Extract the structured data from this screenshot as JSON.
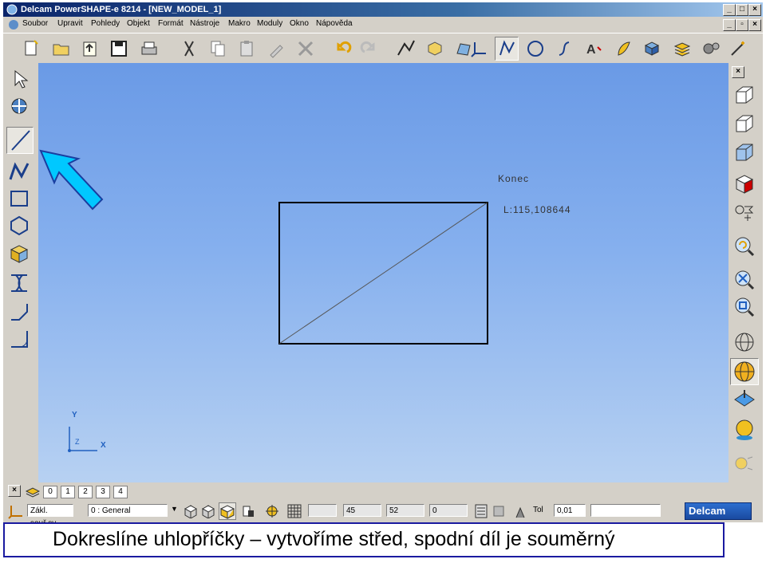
{
  "window": {
    "title": "Delcam PowerSHAPE-e 8214 - [NEW_MODEL_1]"
  },
  "menu": [
    "Soubor",
    "Upravit",
    "Pohledy",
    "Objekt",
    "Formát",
    "Nástroje",
    "Makro",
    "Moduly",
    "Okno",
    "Nápověda"
  ],
  "canvas": {
    "konec_label": "Konec",
    "length_label": "L:115,108644",
    "axis_y": "Y",
    "axis_x": "X",
    "axis_z": "Z"
  },
  "layers": [
    "0",
    "1",
    "2",
    "3",
    "4"
  ],
  "status": {
    "workplane": "Zákl. souř.sy",
    "level": "0  : General",
    "field_45": "45",
    "field_52": "52",
    "field_0": "0",
    "tol_label": "Tol",
    "tol_value": "0,01",
    "brand": "Delcam"
  },
  "caption": "Dokreslíne uhlopříčky – vytvoříme střed, spodní díl je souměrný",
  "colors": {
    "accent_arrow": "#00c8ff",
    "caption_border": "#1a1aa0",
    "canvas_top": "#6a9ae6",
    "canvas_bottom": "#b7d1f2"
  }
}
